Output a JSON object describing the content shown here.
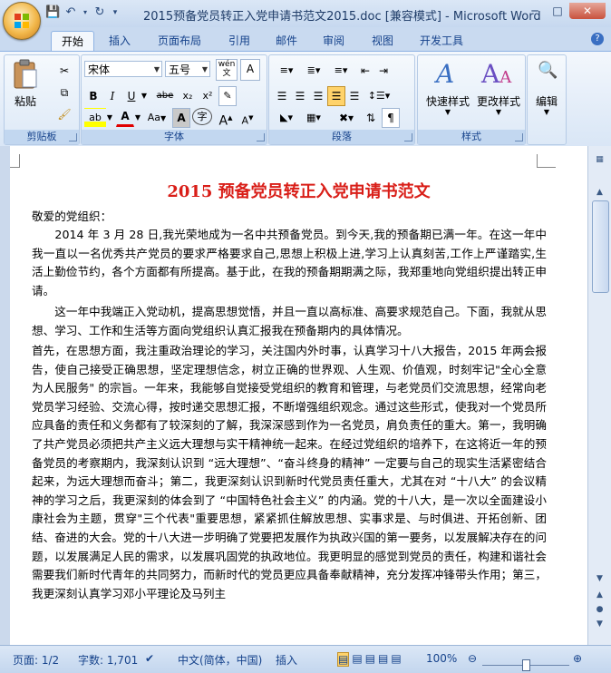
{
  "window": {
    "title": "2015预备党员转正入党申请书范文2015.doc [兼容模式] - Microsoft Word"
  },
  "tabs": [
    "开始",
    "插入",
    "页面布局",
    "引用",
    "邮件",
    "审阅",
    "视图",
    "开发工具"
  ],
  "ribbon": {
    "clipboard": {
      "paste_label": "粘贴",
      "group_label": "剪贴板"
    },
    "font": {
      "font_name": "宋体",
      "font_size": "五号",
      "wen_label": "wén",
      "group_label": "字体",
      "bold": "B",
      "italic": "I",
      "underline": "U",
      "strike": "abe",
      "sub": "x₂",
      "sup": "x²",
      "aa": "Aa",
      "grow": "A",
      "shrink": "A",
      "char_a": "A",
      "circle_char": "字",
      "border_a": "A"
    },
    "paragraph": {
      "group_label": "段落"
    },
    "styles": {
      "quick_styles_label": "快速样式",
      "change_styles_label": "更改样式",
      "group_label": "样式"
    },
    "editing": {
      "label": "编辑"
    }
  },
  "document": {
    "title": "2015 预备党员转正入党申请书范文",
    "paragraphs": [
      "敬爱的党组织：",
      "　　2014 年 3 月 28 日,我光荣地成为一名中共预备党员。到今天,我的预备期已满一年。在这一年中我一直以一名优秀共产党员的要求严格要求自己,思想上积极上进,学习上认真刻苦,工作上严谨踏实,生活上勤俭节约，各个方面都有所提高。基于此，在我的预备期期满之际，我郑重地向党组织提出转正申请。",
      "　　这一年中我端正入党动机，提高思想觉悟，并且一直以高标准、高要求规范自己。下面，我就从思想、学习、工作和生活等方面向党组织认真汇报我在预备期内的具体情况。",
      "首先，在思想方面，我注重政治理论的学习，关注国内外时事，认真学习十八大报告，2015 年两会报告，使自己接受正确思想，坚定理想信念，树立正确的世界观、人生观、价值观，时刻牢记\"全心全意为人民服务\" 的宗旨。一年来，我能够自觉接受党组织的教育和管理，与老党员们交流思想，经常向老党员学习经验、交流心得，按时递交思想汇报，不断增强组织观念。通过这些形式，使我对一个党员所应具备的责任和义务都有了较深刻的了解，我深深感到作为一名党员，肩负责任的重大。第一，我明确了共产党员必须把共产主义远大理想与实干精神统一起来。在经过党组织的培养下，在这将近一年的预备党员的考察期内，我深刻认识到 “远大理想”、“奋斗终身的精神” 一定要与自己的现实生活紧密结合起来，为远大理想而奋斗；第二，我更深刻认识到新时代党员责任重大，尤其在对 “十八大” 的会议精神的学习之后，我更深刻的体会到了 “中国特色社会主义” 的内涵。党的十八大，是一次以全面建设小康社会为主题，贯穿\"三个代表\"重要思想，紧紧抓住解放思想、实事求是、与时俱进、开拓创新、团结、奋进的大会。党的十八大进一步明确了党要把发展作为执政兴国的第一要务，以发展解决存在的问题，以发展满足人民的需求，以发展巩固党的执政地位。我更明显的感觉到党员的责任，构建和谐社会需要我们新时代青年的共同努力，而新时代的党员更应具备奉献精神，充分发挥冲锋带头作用；第三，我更深刻认真学习邓小平理论及马列主"
    ]
  },
  "statusbar": {
    "page": "页面: 1/2",
    "words": "字数: 1,701",
    "language": "中文(简体，中国)",
    "insert_mode": "插入",
    "zoom": "100%",
    "zoom_level_percent": 100
  }
}
